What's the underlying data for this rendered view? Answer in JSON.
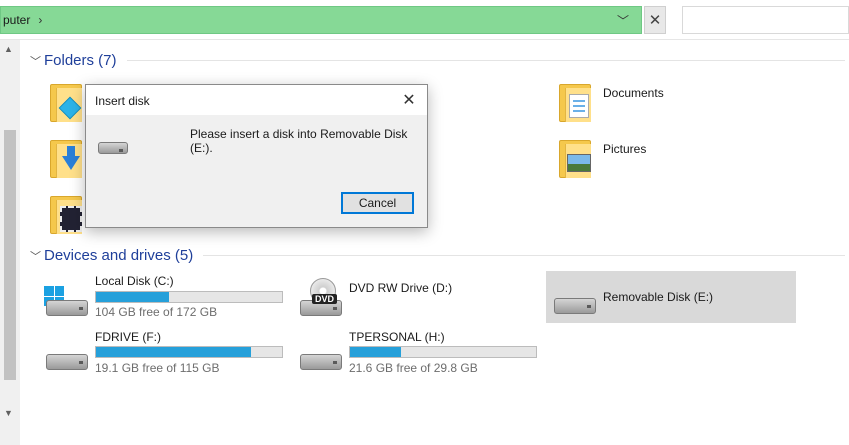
{
  "address_bar": {
    "path_text": "puter",
    "chevron": "›",
    "dropdown_icon": "chevron-down-icon",
    "clear_label": "✕"
  },
  "search": {
    "placeholder": ""
  },
  "sections": {
    "folders": {
      "title": "Folders (7)"
    },
    "drives": {
      "title": "Devices and drives (5)"
    }
  },
  "folders": [
    {
      "name": "Documents",
      "icon": "documents-folder-icon"
    },
    {
      "name": "Pictures",
      "icon": "pictures-folder-icon"
    }
  ],
  "drives": [
    {
      "name": "Local Disk (C:)",
      "free_text": "104 GB free of 172 GB",
      "used_fraction": 0.395,
      "icon": "windows-drive-icon"
    },
    {
      "name": "DVD RW Drive (D:)",
      "icon": "dvd-drive-icon",
      "badge": "DVD"
    },
    {
      "name": "Removable Disk (E:)",
      "icon": "removable-disk-icon"
    },
    {
      "name": "FDRIVE (F:)",
      "free_text": "19.1 GB free of 115 GB",
      "used_fraction": 0.834,
      "icon": "drive-icon"
    },
    {
      "name": "TPERSONAL (H:)",
      "free_text": "21.6 GB free of 29.8 GB",
      "used_fraction": 0.275,
      "icon": "drive-icon"
    }
  ],
  "dialog": {
    "title": "Insert disk",
    "message": "Please insert a disk into Removable Disk (E:).",
    "cancel_label": "Cancel",
    "close_label": "✕"
  },
  "colors": {
    "address_bg": "#86d996",
    "bar_fill": "#26a0da",
    "accent": "#0078d7"
  }
}
